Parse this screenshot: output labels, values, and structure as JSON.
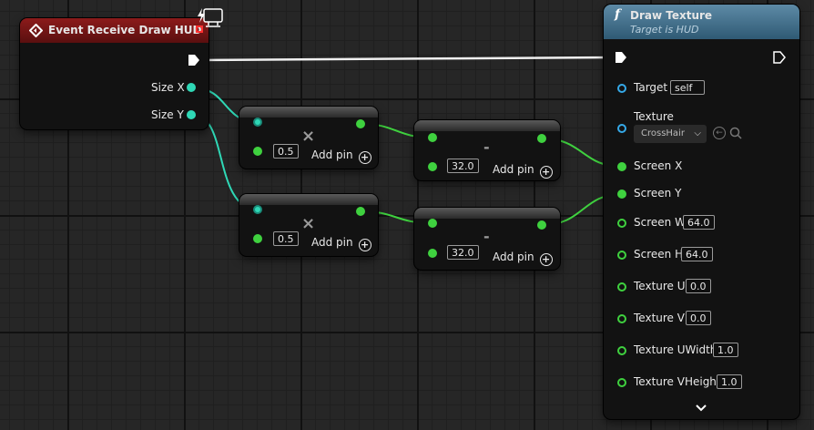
{
  "event_node": {
    "title": "Event Receive Draw HUD",
    "pins": [
      "Size X",
      "Size Y"
    ]
  },
  "draw_node": {
    "title": "Draw Texture",
    "subtitle": "Target is HUD",
    "target_label": "Target",
    "target_value": "self",
    "texture_label": "Texture",
    "texture_value": "CrossHair",
    "pins": [
      {
        "label": "Screen X",
        "value": ""
      },
      {
        "label": "Screen Y",
        "value": ""
      },
      {
        "label": "Screen W",
        "value": "64.0"
      },
      {
        "label": "Screen H",
        "value": "64.0"
      },
      {
        "label": "Texture U",
        "value": "0.0"
      },
      {
        "label": "Texture V",
        "value": "0.0"
      },
      {
        "label": "Texture UWidth",
        "value": "1.0"
      },
      {
        "label": "Texture VHeight",
        "value": "1.0"
      }
    ]
  },
  "mult_nodes": [
    {
      "operator": "×",
      "value": "0.5",
      "add_pin": "Add pin"
    },
    {
      "operator": "×",
      "value": "0.5",
      "add_pin": "Add pin"
    }
  ],
  "sub_nodes": [
    {
      "operator": "-",
      "value": "32.0",
      "add_pin": "Add pin"
    },
    {
      "operator": "-",
      "value": "32.0",
      "add_pin": "Add pin"
    }
  ],
  "icons": {
    "event": "event-diamond-icon",
    "function": "function-f-icon",
    "client": "client-monitor-icon",
    "expand": "chevron-down-icon"
  },
  "colors": {
    "event_header": "#7d1616",
    "function_header": "#3e6a84",
    "float_pin": "#3fd13f",
    "object_pin": "#35a9e8",
    "size_pin": "#2fd8b6",
    "exec_wire": "#ffffff"
  }
}
